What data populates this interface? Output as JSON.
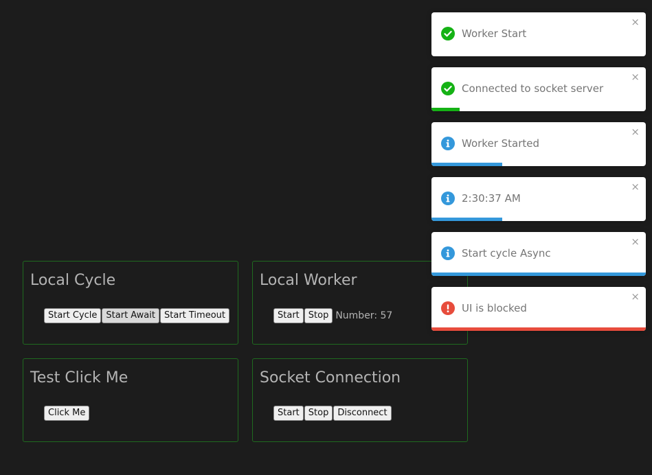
{
  "cards": {
    "local_cycle": {
      "title": "Local Cycle",
      "buttons": [
        "Start Cycle",
        "Start Await",
        "Start Timeout"
      ]
    },
    "local_worker": {
      "title": "Local Worker",
      "buttons": [
        "Start",
        "Stop"
      ],
      "number_text": "Number: 57"
    },
    "test_click": {
      "title": "Test Click Me",
      "buttons": [
        "Click Me"
      ]
    },
    "socket_connection": {
      "title": "Socket Connection",
      "buttons": [
        "Start",
        "Stop",
        "Disconnect"
      ]
    }
  },
  "toasts": [
    {
      "type": "success",
      "icon": "check-circle-icon",
      "message": "Worker Start",
      "close": "×",
      "progress": 0.0,
      "color": "#15b215"
    },
    {
      "type": "success",
      "icon": "check-circle-icon",
      "message": "Connected to socket server",
      "close": "×",
      "progress": 0.13,
      "color": "#15b215"
    },
    {
      "type": "info",
      "icon": "info-circle-icon",
      "message": "Worker Started",
      "close": "×",
      "progress": 0.33,
      "color": "#3498db"
    },
    {
      "type": "info",
      "icon": "info-circle-icon",
      "message": "2:30:37 AM",
      "close": "×",
      "progress": 0.33,
      "color": "#3498db"
    },
    {
      "type": "info",
      "icon": "info-circle-icon",
      "message": "Start cycle Async",
      "close": "×",
      "progress": 1.0,
      "color": "#3498db"
    },
    {
      "type": "error",
      "icon": "exclamation-circle-icon",
      "message": "UI is blocked",
      "close": "×",
      "progress": 1.0,
      "color": "#e74c3c"
    }
  ],
  "colors": {
    "background": "#1c1c1c",
    "card_border": "#1f6b1f",
    "text": "#b4b4b4"
  }
}
